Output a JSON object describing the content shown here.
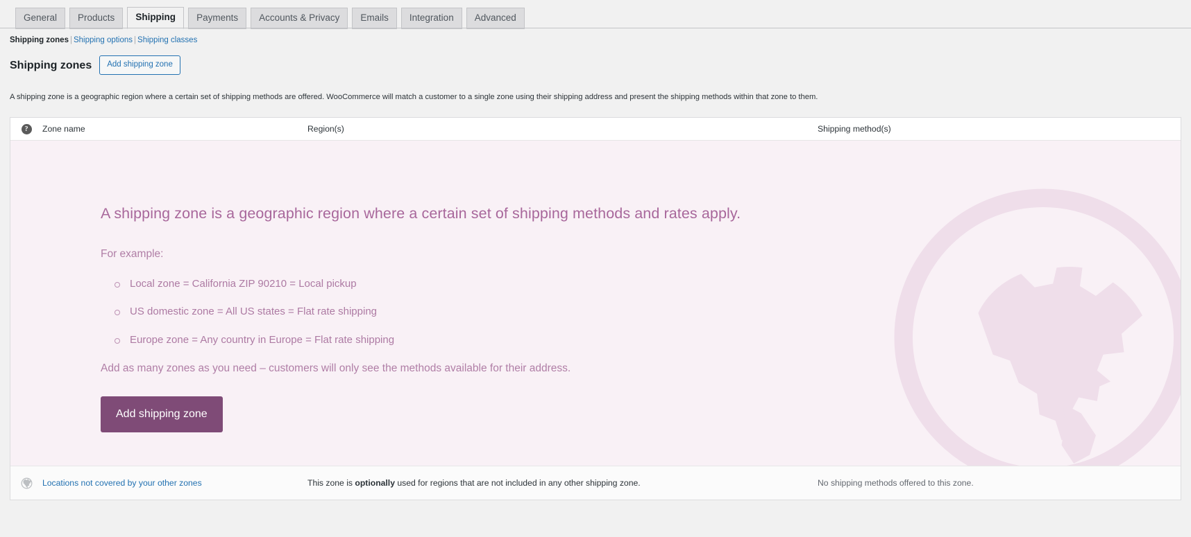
{
  "tabs": [
    {
      "label": "General",
      "active": false
    },
    {
      "label": "Products",
      "active": false
    },
    {
      "label": "Shipping",
      "active": true
    },
    {
      "label": "Payments",
      "active": false
    },
    {
      "label": "Accounts & Privacy",
      "active": false
    },
    {
      "label": "Emails",
      "active": false
    },
    {
      "label": "Integration",
      "active": false
    },
    {
      "label": "Advanced",
      "active": false
    }
  ],
  "subnav": {
    "current": "Shipping zones",
    "separator": "|",
    "links": [
      "Shipping options",
      "Shipping classes"
    ]
  },
  "header": {
    "title": "Shipping zones",
    "add_button": "Add shipping zone",
    "description": "A shipping zone is a geographic region where a certain set of shipping methods are offered. WooCommerce will match a customer to a single zone using their shipping address and present the shipping methods within that zone to them."
  },
  "table": {
    "sort_help_icon": "question-mark-icon",
    "columns": {
      "zone_name": "Zone name",
      "regions": "Region(s)",
      "methods": "Shipping method(s)"
    }
  },
  "empty_state": {
    "watermark_icon": "globe-icon",
    "heading": "A shipping zone is a geographic region where a certain set of shipping methods and rates apply.",
    "lead": "For example:",
    "examples": [
      "Local zone = California ZIP 90210 = Local pickup",
      "US domestic zone = All US states = Flat rate shipping",
      "Europe zone = Any country in Europe = Flat rate shipping"
    ],
    "closing": "Add as many zones as you need – customers will only see the methods available for their address.",
    "cta_button": "Add shipping zone"
  },
  "fallback_row": {
    "globe_icon": "globe-icon",
    "link": "Locations not covered by your other zones",
    "note_prefix": "This zone is ",
    "note_emphasis": "optionally",
    "note_suffix": " used for regions that are not included in any other shipping zone.",
    "methods": "No shipping methods offered to this zone."
  },
  "colors": {
    "accent_purple": "#7f4b77",
    "panel_background": "#f9f1f6",
    "link_blue": "#2271b1",
    "page_background": "#f1f1f1"
  }
}
